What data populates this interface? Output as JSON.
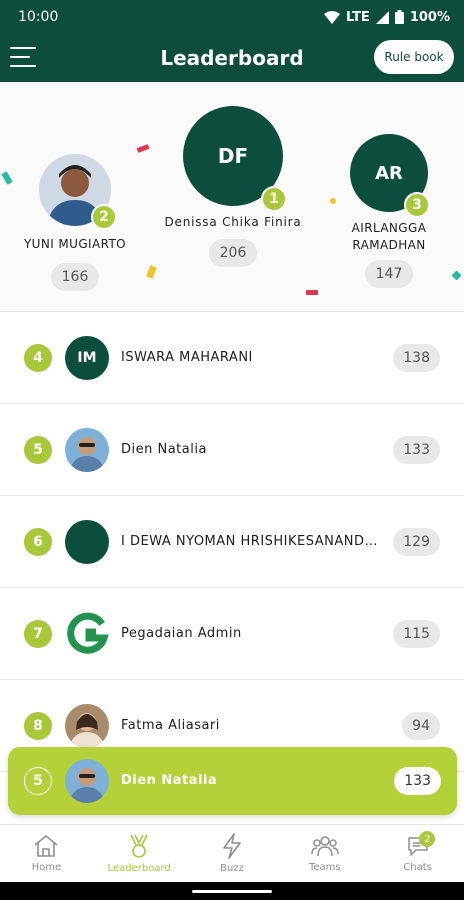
{
  "status": {
    "time": "10:00",
    "network": "LTE",
    "battery": "100%"
  },
  "header": {
    "title": "Leaderboard",
    "rulebook_label": "Rule book"
  },
  "podium": [
    {
      "rank": "2",
      "name": "YUNI MUGIARTO",
      "score": "166",
      "initials": ""
    },
    {
      "rank": "1",
      "name": "Denissa Chika Finira",
      "score": "206",
      "initials": "DF"
    },
    {
      "rank": "3",
      "name": "AIRLANGGA RAMADHAN",
      "score": "147",
      "initials": "AR"
    }
  ],
  "list": [
    {
      "rank": "4",
      "name": "ISWARA MAHARANI",
      "score": "138",
      "initials": "IM",
      "avatar": "initials"
    },
    {
      "rank": "5",
      "name": "Dien Natalia",
      "score": "133",
      "initials": "",
      "avatar": "photo"
    },
    {
      "rank": "6",
      "name": "I DEWA NYOMAN HRISHIKESANAND…",
      "score": "129",
      "initials": "",
      "avatar": "solid"
    },
    {
      "rank": "7",
      "name": "Pegadaian Admin",
      "score": "115",
      "initials": "",
      "avatar": "logo"
    },
    {
      "rank": "8",
      "name": "Fatma  Aliasari",
      "score": "94",
      "initials": "",
      "avatar": "photo"
    }
  ],
  "my_rank": {
    "rank": "5",
    "name": "Dien Natalia",
    "score": "133"
  },
  "nav": [
    {
      "label": "Home",
      "icon": "home-icon"
    },
    {
      "label": "Leaderboard",
      "icon": "medal-icon"
    },
    {
      "label": "Buzz",
      "icon": "lightning-icon"
    },
    {
      "label": "Teams",
      "icon": "people-icon"
    },
    {
      "label": "Chats",
      "icon": "chat-icon",
      "badge": "2"
    }
  ],
  "colors": {
    "primary": "#0d4d3e",
    "accent": "#a8c73a"
  }
}
